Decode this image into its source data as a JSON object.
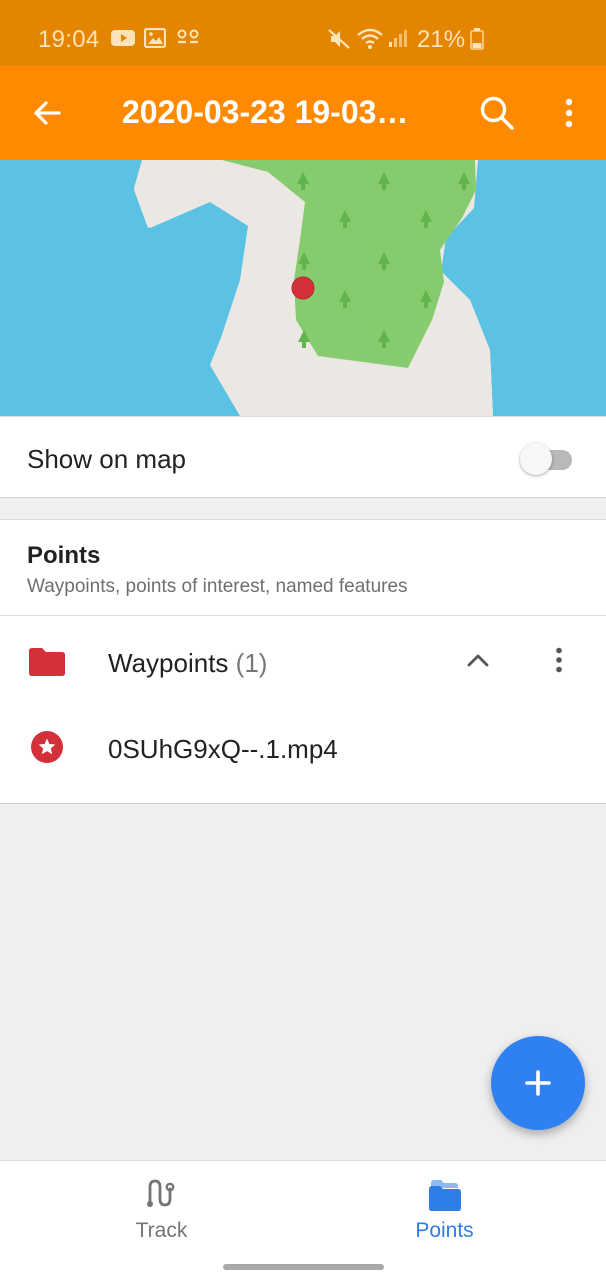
{
  "status_bar": {
    "time": "19:04",
    "battery_percent": "21%",
    "icons": [
      "youtube-notification-icon",
      "gallery-notification-icon",
      "voicemail-icon",
      "mute-icon",
      "wifi-icon",
      "signal-icon",
      "battery-icon"
    ]
  },
  "app_bar": {
    "title": "2020-03-23 19-03…",
    "icons": [
      "back-arrow-icon",
      "search-icon",
      "more-vert-icon"
    ],
    "background_color": "#ff8a00"
  },
  "map": {
    "icons": [
      "waypoint-marker-icon",
      "tree-icon"
    ],
    "colors": {
      "water": "#5bc2e4",
      "land": "#ebe8e4",
      "forest": "#86cc6e",
      "marker": "#d3303a"
    }
  },
  "show_on_map": {
    "label": "Show on map",
    "enabled": false
  },
  "points": {
    "heading": "Points",
    "subtitle": "Waypoints, points of interest, named features",
    "folder": {
      "name": "Waypoints",
      "count": "(1)",
      "color": "#d3303a",
      "icons": [
        "folder-icon",
        "chevron-up-icon",
        "more-vert-icon"
      ]
    },
    "items": [
      {
        "name": "0SUhG9xQ--.1.mp4",
        "icon": "star-circle-icon"
      }
    ]
  },
  "fab": {
    "icon": "add-icon",
    "color": "#2f81f3"
  },
  "bottom_nav": {
    "items": [
      {
        "label": "Track",
        "icon": "track-route-icon",
        "selected": false
      },
      {
        "label": "Points",
        "icon": "points-folder-icon",
        "selected": true
      }
    ],
    "accent_color": "#2f7de6"
  }
}
